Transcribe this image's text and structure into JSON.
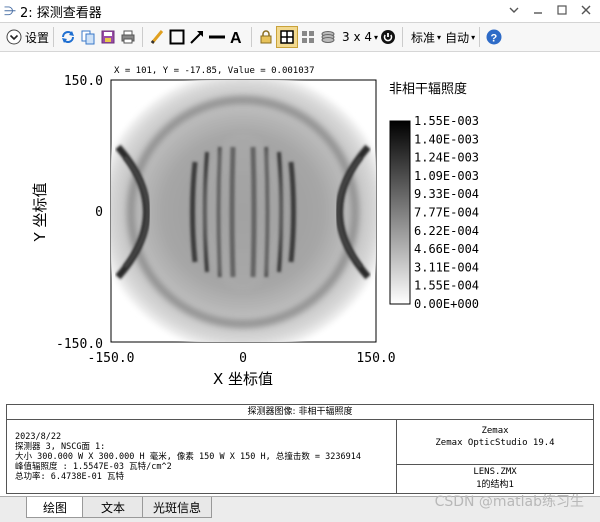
{
  "window": {
    "title": "2: 探测查看器"
  },
  "toolbar": {
    "settings_label": "设置",
    "layout_label": "3 x 4",
    "standard_label": "标准",
    "auto_label": "自动"
  },
  "plot": {
    "status_line": "X = 101, Y = -17.85, Value = 0.001037",
    "legend_title": "非相干辐照度",
    "x_label": "X 坐标值",
    "y_label": "Y 坐标值",
    "x_ticks": [
      "-150.0",
      "0",
      "150.0"
    ],
    "y_ticks": [
      "150.0",
      "0",
      "-150.0"
    ],
    "colorbar_ticks": [
      "1.55E-003",
      "1.40E-003",
      "1.24E-003",
      "1.09E-003",
      "9.33E-004",
      "7.77E-004",
      "6.22E-004",
      "4.66E-004",
      "3.11E-004",
      "1.55E-004",
      "0.00E+000"
    ]
  },
  "info": {
    "header": "探测器图像: 非相干辐照度",
    "lines": [
      "2023/8/22",
      "探测器 3, NSCG面 1:",
      "大小 300.000 W X 300.000 H 毫米, 像素 150 W X 150 H, 总撞击数 = 3236914",
      "峰值辐照度 : 1.5547E-03 瓦特/cm^2",
      "总功率: 6.4738E-01 瓦特"
    ],
    "right_top_1": "Zemax",
    "right_top_2": "Zemax OpticStudio 19.4",
    "right_bottom_1": "LENS.ZMX",
    "right_bottom_2": "1的结构1"
  },
  "tabs": [
    "绘图",
    "文本",
    "光斑信息"
  ],
  "watermark": "CSDN @matlab练习生"
}
